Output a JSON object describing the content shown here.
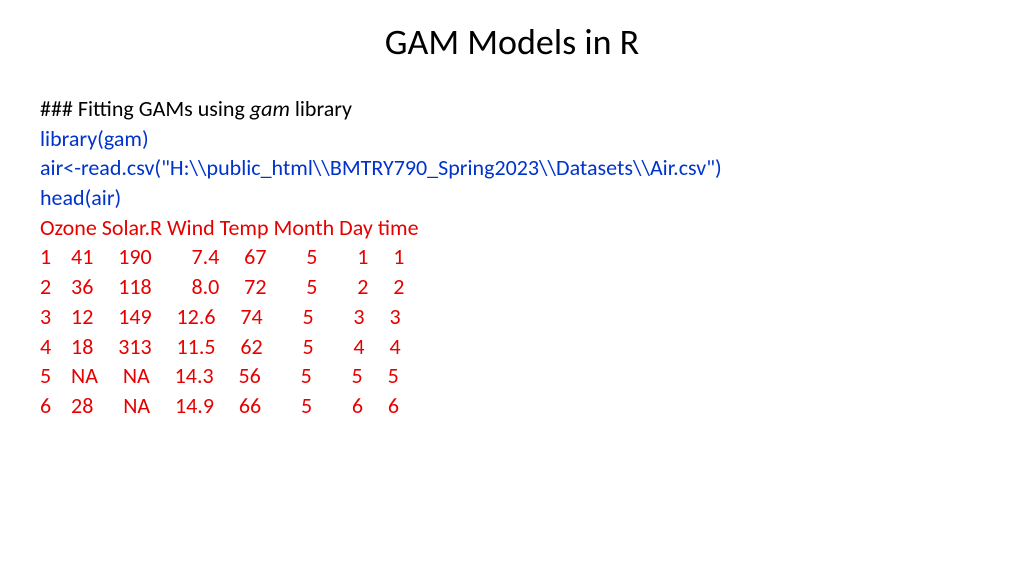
{
  "title": "GAM Models in R",
  "section": {
    "prefix": "### Fitting GAMs using ",
    "italic": "gam",
    "suffix": " library"
  },
  "code": {
    "l1": "library(gam)",
    "l2": "air<-read.csv(\"H:\\\\public_html\\\\BMTRY790_Spring2023\\\\Datasets\\\\Air.csv\")",
    "l3": "head(air)"
  },
  "output": {
    "header": "   Ozone Solar.R Wind  Temp Month Day  time",
    "rows": [
      "1    41     190        7.4     67        5        1     1",
      "2    36     118        8.0     72        5        2     2",
      "3    12     149     12.6     74        5        3     3",
      "4    18     313     11.5     62        5        4     4",
      "5    NA     NA     14.3     56        5        5     5",
      "6    28      NA     14.9     66        5        6     6"
    ]
  },
  "chart_data": {
    "type": "table",
    "title": "head(air)",
    "columns": [
      "",
      "Ozone",
      "Solar.R",
      "Wind",
      "Temp",
      "Month",
      "Day",
      "time"
    ],
    "rows": [
      [
        "1",
        41,
        190,
        7.4,
        67,
        5,
        1,
        1
      ],
      [
        "2",
        36,
        118,
        8.0,
        72,
        5,
        2,
        2
      ],
      [
        "3",
        12,
        149,
        12.6,
        74,
        5,
        3,
        3
      ],
      [
        "4",
        18,
        313,
        11.5,
        62,
        5,
        4,
        4
      ],
      [
        "5",
        "NA",
        "NA",
        14.3,
        56,
        5,
        5,
        5
      ],
      [
        "6",
        28,
        "NA",
        14.9,
        66,
        5,
        6,
        6
      ]
    ]
  }
}
